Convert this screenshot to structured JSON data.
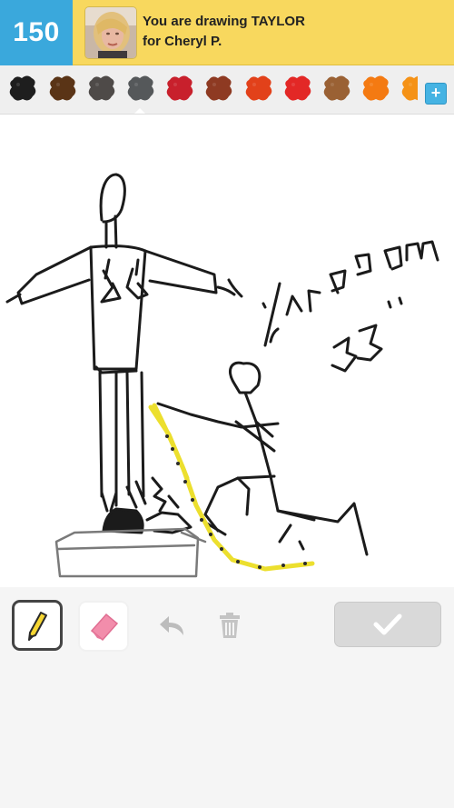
{
  "header": {
    "score": "150",
    "drawing_line": "You are drawing TAYLOR",
    "for_line": "for Cheryl P.",
    "colors": {
      "score_bg": "#3aa8dc",
      "bar_bg": "#f8d85e"
    }
  },
  "palette": {
    "swatches": [
      {
        "name": "black",
        "color": "#1e1e1e"
      },
      {
        "name": "dark-brown",
        "color": "#5a3416"
      },
      {
        "name": "dark-gray",
        "color": "#4e4a48"
      },
      {
        "name": "gray",
        "color": "#55585a"
      },
      {
        "name": "crimson",
        "color": "#c8202c"
      },
      {
        "name": "rust-brown",
        "color": "#8e3a22"
      },
      {
        "name": "red-orange",
        "color": "#e2411a"
      },
      {
        "name": "red",
        "color": "#e32826"
      },
      {
        "name": "tan-brown",
        "color": "#9a6134"
      },
      {
        "name": "orange",
        "color": "#f47a12"
      },
      {
        "name": "light-orange",
        "color": "#f59216"
      }
    ],
    "selected": "gray",
    "add_label": "+"
  },
  "canvas": {
    "label_text_1": "inseam",
    "label_text_2": "33\""
  },
  "toolbar": {
    "tools": [
      "pencil",
      "eraser",
      "undo",
      "trash",
      "done"
    ],
    "selected_tool": "pencil"
  }
}
